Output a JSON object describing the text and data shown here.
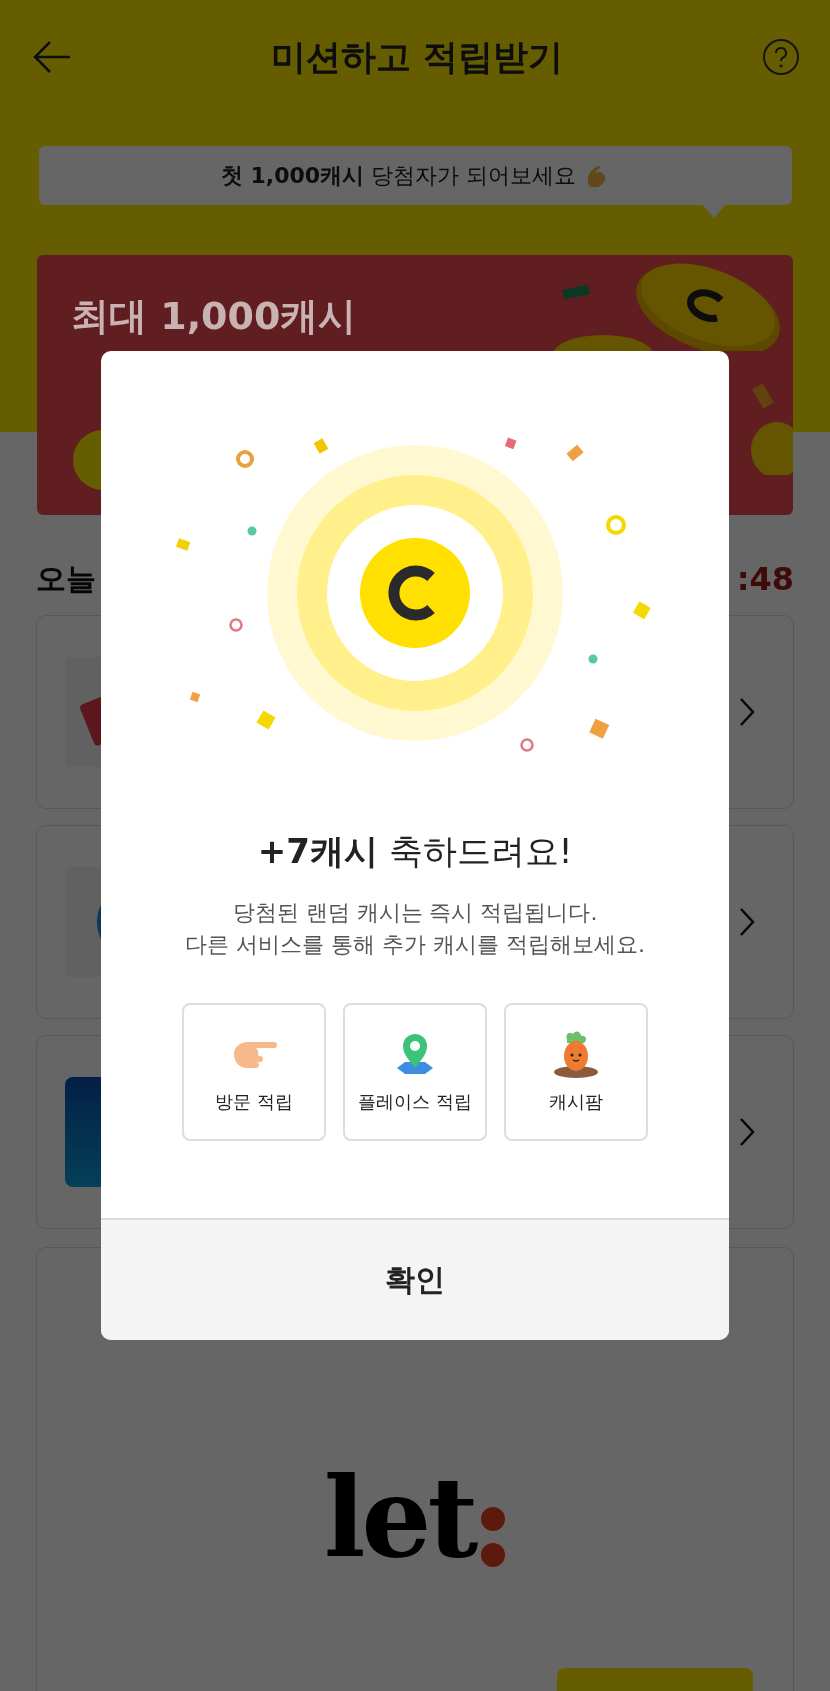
{
  "header": {
    "title": "미션하고 적립받기"
  },
  "tooltip": {
    "text": "**첫 1,000캐시** 당첨자가 되어보세요"
  },
  "banner": {
    "title": "최대 1,000캐시"
  },
  "section": {
    "title": "오늘",
    "timer": ":48"
  },
  "missions": [
    {
      "kind": "red-tag"
    },
    {
      "kind": "blue-ring"
    },
    {
      "kind": "blue-tile"
    }
  ],
  "featured": {
    "logo": "let"
  },
  "modal": {
    "heading": "**+7캐시** 축하드려요!",
    "message": [
      "당첨된 랜덤 캐시는 즉시 적립됩니다.",
      "다른 서비스를 통해 추가 캐시를 적립해보세요."
    ],
    "shortcuts": [
      {
        "kind": "hand",
        "label": "방문 적립"
      },
      {
        "kind": "pin",
        "label": "플레이스 적립"
      },
      {
        "kind": "carrot",
        "label": "캐시팜"
      }
    ],
    "confirm": "확인"
  }
}
